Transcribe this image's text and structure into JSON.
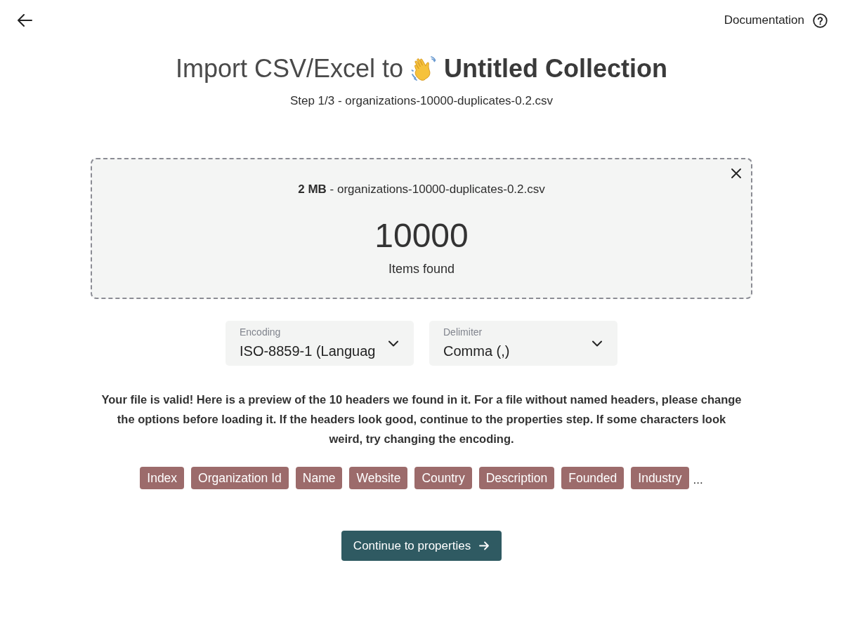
{
  "top_bar": {
    "documentation_link": "Documentation"
  },
  "header": {
    "title_prefix": "Import CSV/Excel to",
    "collection_name": "Untitled Collection",
    "step": "Step 1/3 - organizations-10000-duplicates-0.2.csv"
  },
  "file_summary": {
    "size_and_name": "**2 MB** - organizations-10000-duplicates-0.2.csv",
    "item_count": "10000",
    "item_count_label": "Items found"
  },
  "options": [
    {
      "label": "Encoding",
      "value": "ISO-8859-1 (Languag"
    },
    {
      "label": "Delimiter",
      "value": "Comma (,)"
    }
  ],
  "message": "Your file is valid! Here is a preview of the 10 headers we found in it. For a file without named headers, please change the options before loading it. If the headers look good, continue to the properties step. If some characters look weird, try changing the encoding.",
  "headers_preview": {
    "headers": [
      "Index",
      "Organization Id",
      "Name",
      "Website",
      "Country",
      "Description",
      "Founded",
      "Industry"
    ],
    "more": "..."
  },
  "continue_button": "Continue to properties"
}
